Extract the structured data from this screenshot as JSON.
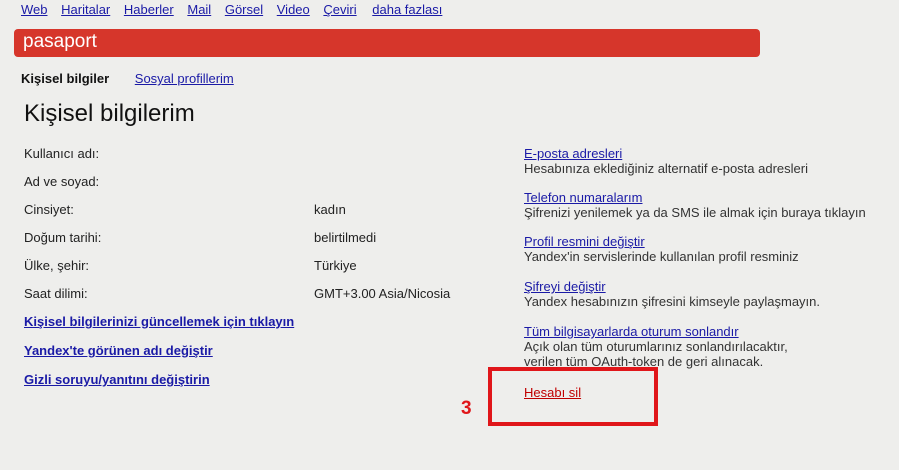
{
  "topnav": {
    "items": [
      "Web",
      "Haritalar",
      "Haberler",
      "Mail",
      "Görsel",
      "Video",
      "Çeviri"
    ],
    "more": "daha fazlası"
  },
  "brand": {
    "name": "pasaport",
    "bar_color": "#d6362b"
  },
  "tabs": {
    "active": "Kişisel bilgiler",
    "other": "Sosyal profillerim"
  },
  "page_title": "Kişisel bilgilerim",
  "info": [
    {
      "label": "Kullanıcı adı:",
      "value": ""
    },
    {
      "label": "Ad ve soyad:",
      "value": ""
    },
    {
      "label": "Cinsiyet:",
      "value": "kadın"
    },
    {
      "label": "Doğum tarihi:",
      "value": "belirtilmedi"
    },
    {
      "label": "Ülke, şehir:",
      "value": "Türkiye"
    },
    {
      "label": "Saat dilimi:",
      "value": "GMT+3.00 Asia/Nicosia"
    }
  ],
  "actions": {
    "update": "Kişisel bilgilerinizi güncellemek için tıklayın",
    "rename": "Yandex'te görünen adı değiştir",
    "secret": "Gizli soruyu/yanıtını değiştirin"
  },
  "side": [
    {
      "link": "E-posta adresleri",
      "desc": "Hesabınıza eklediğiniz alternatif e-posta adresleri"
    },
    {
      "link": "Telefon numaralarım",
      "desc": "Şifrenizi yenilemek ya da SMS ile almak için buraya tıklayın"
    },
    {
      "link": "Profil resmini değiştir",
      "desc": "Yandex'in servislerinde kullanılan profil resminiz"
    },
    {
      "link": "Şifreyi değiştir",
      "desc": "Yandex hesabınızın şifresini kimseyle paylaşmayın."
    },
    {
      "link": "Tüm bilgisayarlarda oturum sonlandır",
      "desc": "Açık olan tüm oturumlarınız sonlandırılacaktır,",
      "desc2": "verilen tüm OAuth-token de geri alınacak."
    }
  ],
  "delete_account": "Hesabı sil",
  "annotation": {
    "number": "3",
    "color": "#e0161a"
  }
}
